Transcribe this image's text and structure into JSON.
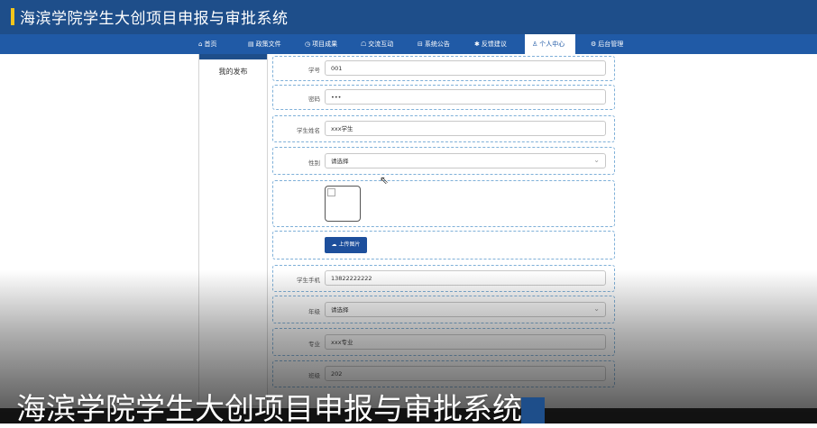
{
  "header": {
    "title": "海滨学院学生大创项目申报与审批系统"
  },
  "nav": {
    "items": [
      {
        "icon": "⌂",
        "label": "首页"
      },
      {
        "icon": "▤",
        "label": "政策文件"
      },
      {
        "icon": "◷",
        "label": "项目成果"
      },
      {
        "icon": "☖",
        "label": "交流互动"
      },
      {
        "icon": "⊟",
        "label": "系统公告"
      },
      {
        "icon": "✱",
        "label": "反馈建议"
      },
      {
        "icon": "♙",
        "label": "个人中心"
      },
      {
        "icon": "⚙",
        "label": "后台管理"
      }
    ],
    "active_index": 6
  },
  "sidebar": {
    "item": "我的发布"
  },
  "form": {
    "student_no": {
      "label": "学号",
      "value": "001"
    },
    "password": {
      "label": "密码",
      "value": "•••"
    },
    "student_name": {
      "label": "学生姓名",
      "value": "xxx学生"
    },
    "gender": {
      "label": "性别",
      "value": "请选择"
    },
    "upload_label": "上传图片",
    "phone": {
      "label": "学生手机",
      "value": "13822222222"
    },
    "grade": {
      "label": "年级",
      "value": "请选择"
    },
    "major": {
      "label": "专业",
      "value": "xxx专业"
    },
    "class": {
      "label": "班级",
      "value": "202"
    }
  },
  "caption": "海滨学院学生大创项目申报与审批系统"
}
